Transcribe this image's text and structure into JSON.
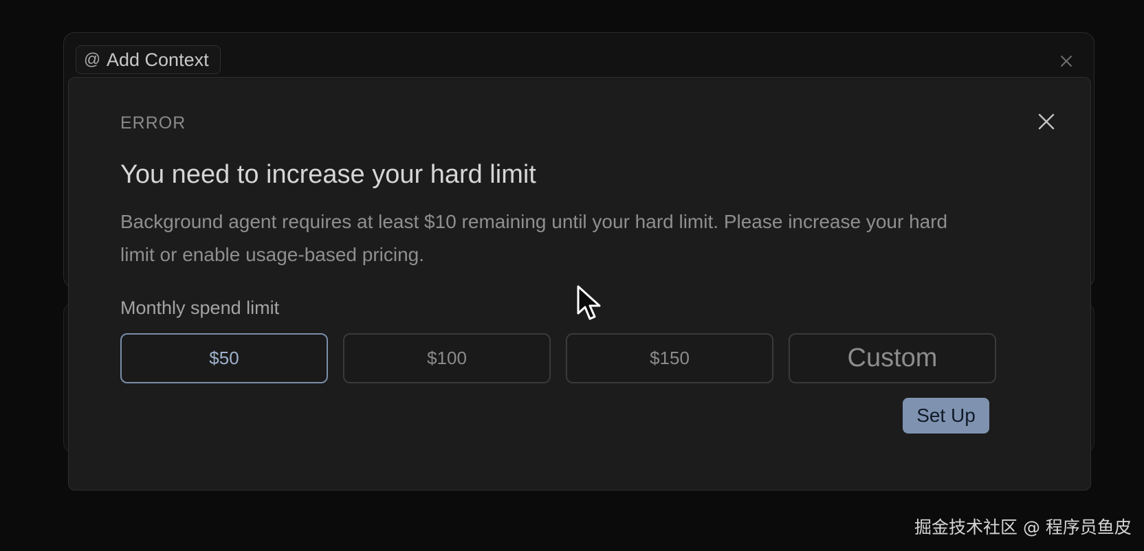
{
  "background": {
    "add_context_label": "Add Context",
    "icons": {
      "at": "at-icon",
      "close": "close-icon"
    }
  },
  "modal": {
    "kicker": "ERROR",
    "title": "You need to increase your hard limit",
    "body": "Background agent requires at least $10 remaining until your hard limit. Please increase your hard limit or enable usage-based pricing.",
    "spend_limit_label": "Monthly spend limit",
    "options": [
      {
        "label": "$50",
        "selected": true
      },
      {
        "label": "$100",
        "selected": false
      },
      {
        "label": "$150",
        "selected": false
      },
      {
        "label": "Custom",
        "selected": false
      }
    ],
    "setup_label": "Set Up"
  },
  "watermark": "掘金技术社区 @ 程序员鱼皮",
  "colors": {
    "page_bg": "#0b0b0b",
    "modal_bg": "#1c1c1c",
    "selected_border": "#7b8eaa",
    "primary_button": "#7f93b1"
  }
}
